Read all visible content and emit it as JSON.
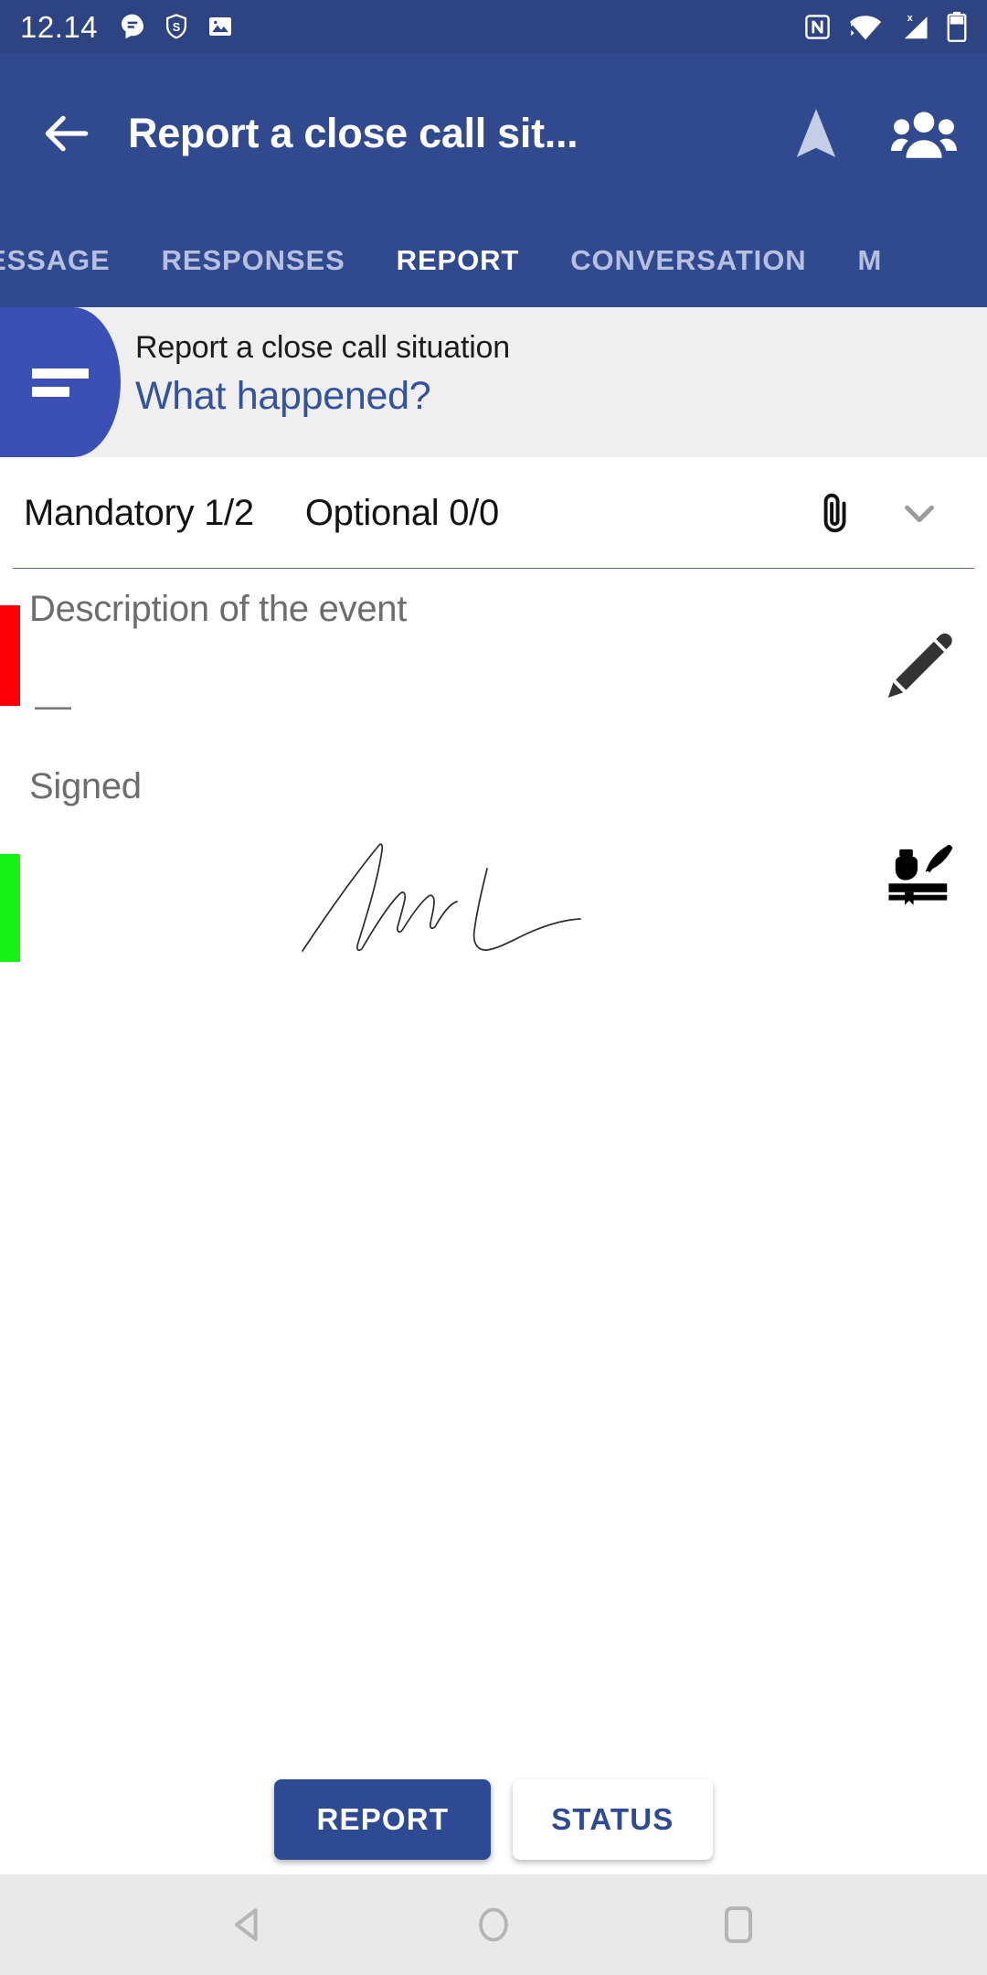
{
  "status_bar": {
    "time": "12.14",
    "left_icons": [
      "message-icon",
      "shield-s-icon",
      "photo-icon"
    ],
    "right_icons": [
      "nfc-icon",
      "wifi-icon",
      "signal-no-sim-icon",
      "battery-icon"
    ]
  },
  "app_bar": {
    "back_icon": "back-arrow-icon",
    "title": "Report a close call sit...",
    "navigate_icon": "navigation-arrow-icon",
    "people_icon": "people-group-icon"
  },
  "tabs": [
    {
      "label": "ESSAGE",
      "active": false
    },
    {
      "label": "RESPONSES",
      "active": false
    },
    {
      "label": "REPORT",
      "active": true
    },
    {
      "label": "CONVERSATION",
      "active": false
    },
    {
      "label": "M",
      "active": false
    }
  ],
  "question_header": {
    "tab_icon": "list-lines-icon",
    "subtitle": "Report a close call situation",
    "title": "What happened?"
  },
  "counts": {
    "mandatory": "Mandatory 1/2",
    "optional": "Optional 0/0",
    "attach_icon": "paperclip-icon",
    "expand_icon": "chevron-down-icon"
  },
  "fields": [
    {
      "label": "Description of the event",
      "value": "—",
      "status_color": "#fb0007",
      "action_icon": "pen-icon"
    },
    {
      "label": "Signed",
      "value": "",
      "status_color": "#16f216",
      "action_icon": "quill-inkwell-icon"
    }
  ],
  "bottom_buttons": [
    {
      "label": "REPORT",
      "style": "primary"
    },
    {
      "label": "STATUS",
      "style": "secondary"
    }
  ],
  "nav_bar": {
    "back": "triangle-back-icon",
    "home": "circle-home-icon",
    "recents": "square-recents-icon"
  },
  "colors": {
    "status_bar": "#2d4382",
    "app_bar": "#31498f",
    "accent_blue": "#3c4fb5",
    "card_gray": "#efefef",
    "required_red": "#fb0007",
    "complete_green": "#16f216"
  }
}
